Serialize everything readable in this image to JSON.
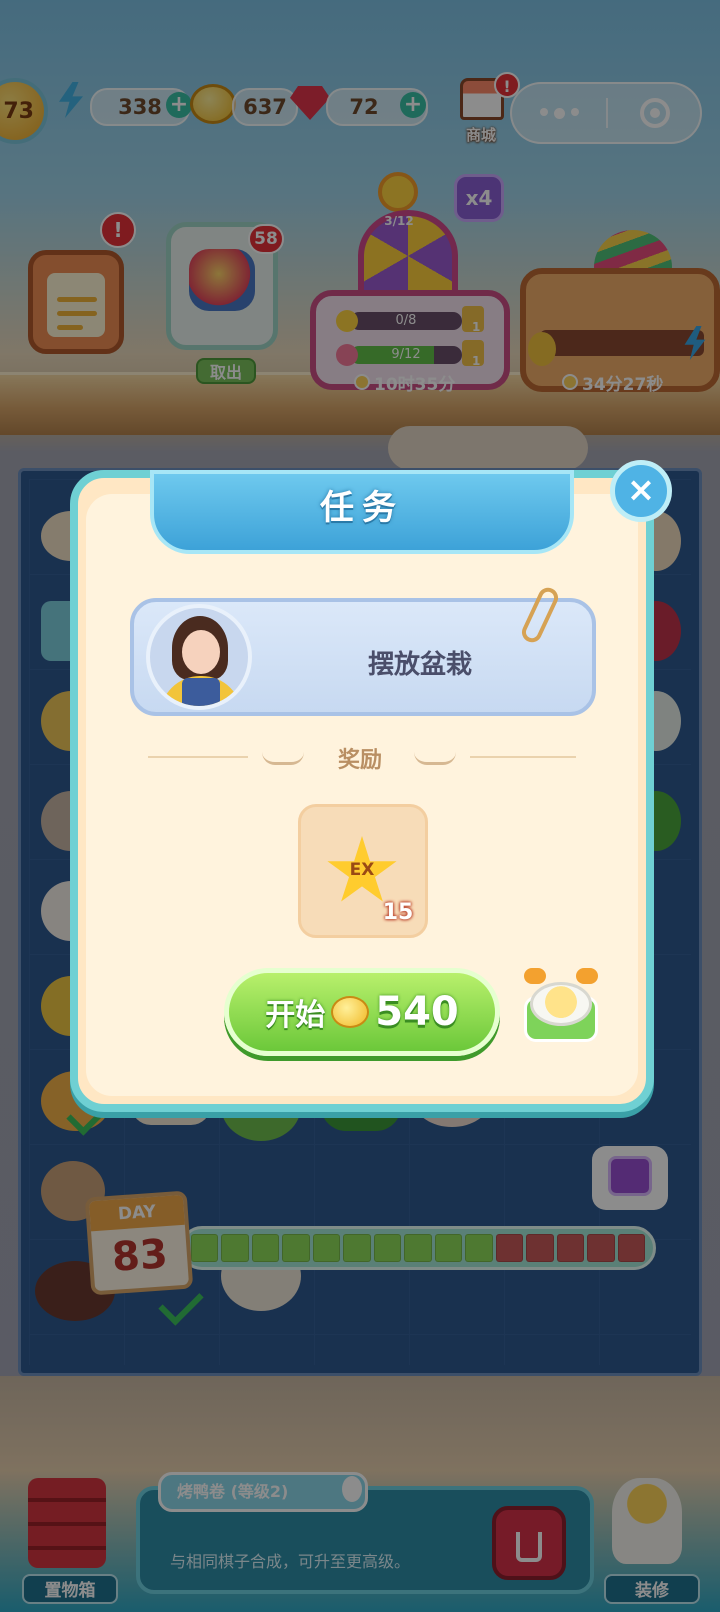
{
  "hud": {
    "level": "73",
    "energy": "338",
    "coins": "637",
    "gems": "72",
    "shop_label": "商城",
    "shop_badge": "!"
  },
  "features": {
    "clipboard_badge": "!",
    "storage_count": "58",
    "storage_button": "取出",
    "wheel_progress": "3/12",
    "multiplier": "x4",
    "task_bar_1": "0/8",
    "task_bar_2": "9/12",
    "wheel_bar_1_reward": "1",
    "wheel_bar_2_reward": "1",
    "wheel_timer": "10时35分",
    "egg_timer": "34分27秒"
  },
  "modal": {
    "title": "任务",
    "task_name": "摆放盆栽",
    "reward_heading": "奖励",
    "reward_icon_text": "EX",
    "reward_count": "15",
    "start_label": "开始",
    "start_cost": "540"
  },
  "day": {
    "label": "DAY",
    "number": "83",
    "progress_filled": 10,
    "progress_total": 15
  },
  "bottom": {
    "storage_box_label": "置物箱",
    "decorate_label": "装修",
    "item_title": "烤鸭卷 (等级2)",
    "item_desc": "与相同棋子合成，可升至更高级。"
  },
  "colors": {
    "accent_green": "#6cc83a",
    "modal_border": "#6fd0d3",
    "progress_done": "#8fdc5a",
    "progress_todo": "#c95a5a"
  }
}
